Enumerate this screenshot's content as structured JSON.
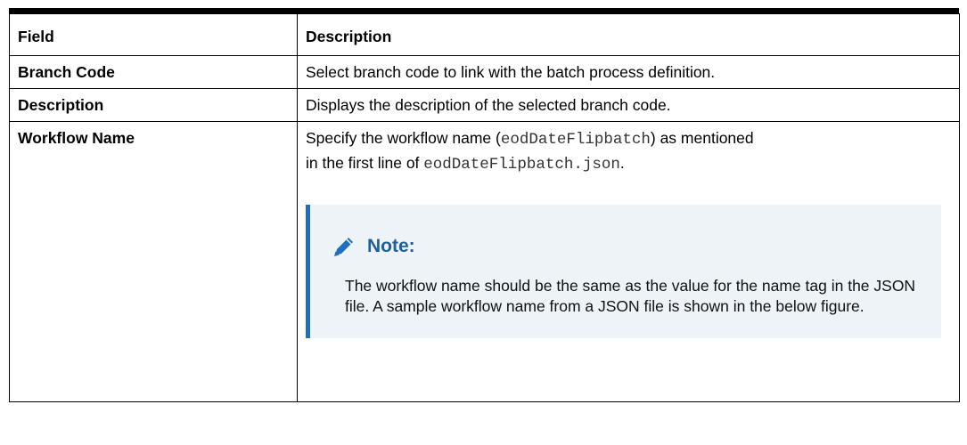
{
  "table": {
    "header": {
      "field": "Field",
      "description": "Description"
    },
    "rows": [
      {
        "field": "Branch Code",
        "description": "Select branch code to link with the batch process definition."
      },
      {
        "field": "Description",
        "description": "Displays the description of the selected branch code."
      },
      {
        "field": "Workflow Name",
        "description_part1": "Specify the workflow name (",
        "description_code1": "eodDateFlipbatch",
        "description_part2": ") as mentioned",
        "description_part3": "in the first line of ",
        "description_code2": "eodDateFlipbatch.json",
        "description_part4": ".",
        "note": {
          "icon": "pencil-icon",
          "title": "Note:",
          "body": "The workflow name should be the same as the value for the name tag in the JSON file. A sample workflow name from a JSON file is shown in the below figure."
        }
      }
    ]
  },
  "colors": {
    "note_accent": "#1f6fbf",
    "note_bg": "#eef3f8",
    "note_title": "#1f5f9e"
  }
}
